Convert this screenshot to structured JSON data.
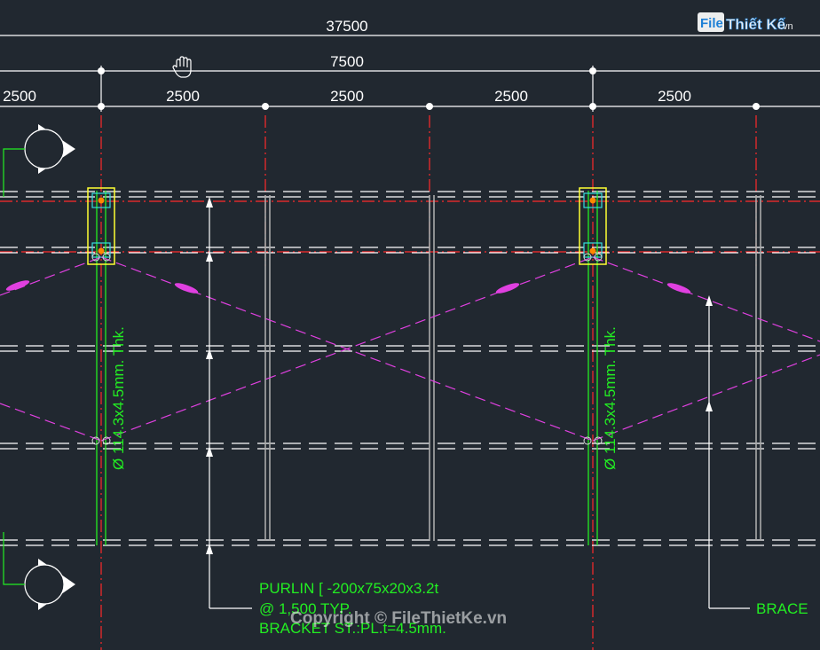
{
  "drawing": {
    "dimensions": {
      "overall": "37500",
      "bay": "7500",
      "spacings": [
        "2500",
        "2500",
        "2500",
        "2500",
        "2500"
      ]
    },
    "column_labels": [
      "Ø 114.3x4.5mm. Thk.",
      "Ø 114.3x4.5mm. Thk."
    ],
    "purlin_note": {
      "line1": "PURLIN [  -200x75x20x3.2t",
      "line2": "@ 1,500 TYP.",
      "line3": "BRACKET ST.:PL.t=4.5mm."
    },
    "brace_label": "BRACE"
  },
  "watermark": {
    "logo_file": "File",
    "logo_name": "Thiết Kế",
    "logo_tld": ".vn",
    "copyright": "Copyright © FileThietKe.vn"
  },
  "colors": {
    "background": "#212830",
    "dimension": "#ffffff",
    "axis": "#ff2a2a",
    "annotation": "#22ee22",
    "brace": "#e040e0",
    "bracket": "#ffff33",
    "purlin": "#ffffff",
    "girt": "#b0b0b0"
  },
  "icons": [
    "hand-pan-icon",
    "grid-bubble-icon"
  ]
}
